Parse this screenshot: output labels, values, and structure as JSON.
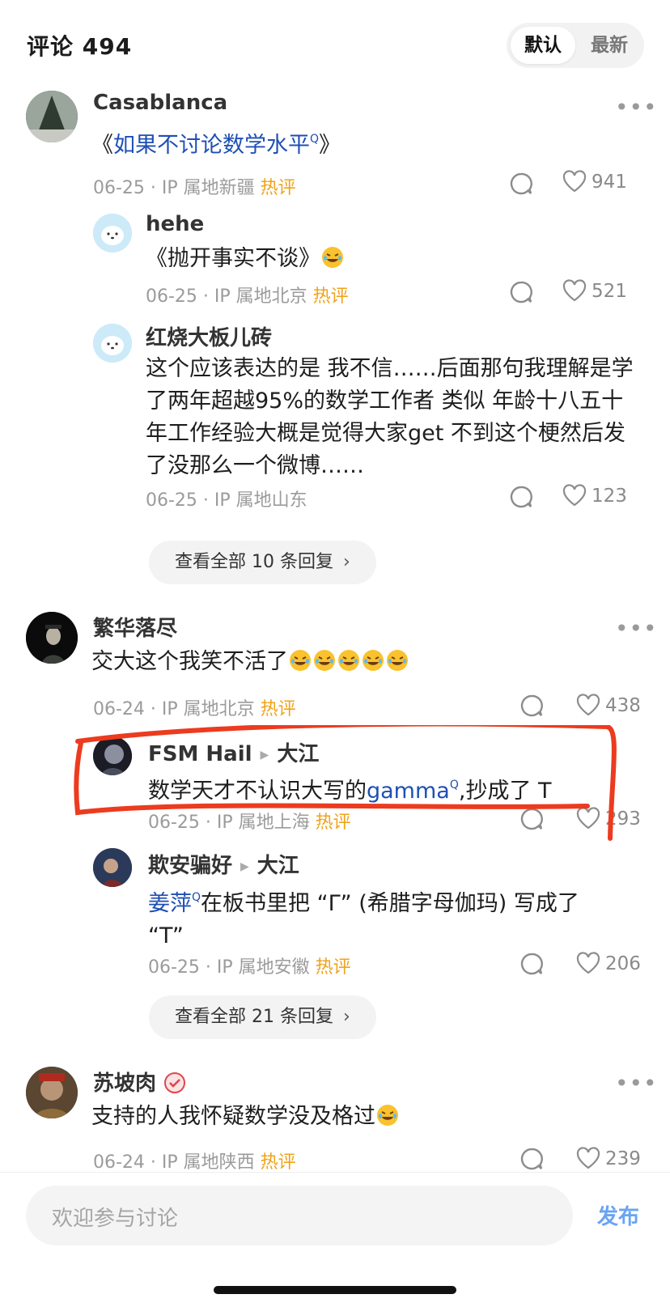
{
  "header": {
    "title": "评论 494",
    "sort_default": "默认",
    "sort_latest": "最新"
  },
  "comments": [
    {
      "user": "Casablanca",
      "text_prefix": "《",
      "text_link": "如果不讨论数学水平",
      "text_suffix": "》",
      "date": "06-25",
      "location": "IP 属地新疆",
      "tag": "热评",
      "likes": "941",
      "replies": [
        {
          "user": "hehe",
          "text": "《抛开事实不谈》",
          "date": "06-25",
          "location": "IP 属地北京",
          "tag": "热评",
          "likes": "521"
        },
        {
          "user": "红烧大板儿砖",
          "text": "这个应该表达的是 我不信……后面那句我理解是学了两年超越95%的数学工作者 类似 年龄十八五十年工作经验大概是觉得大家get 不到这个梗然后发了没那么一个微博……",
          "date": "06-25",
          "location": "IP 属地山东",
          "tag": "",
          "likes": "123"
        }
      ],
      "view_all": "查看全部 10 条回复"
    },
    {
      "user": "繁华落尽",
      "text": "交大这个我笑不活了",
      "date": "06-24",
      "location": "IP 属地北京",
      "tag": "热评",
      "likes": "438",
      "replies": [
        {
          "user": "FSM Hail",
          "reply_to": "大江",
          "text_prefix": "数学天才不认识大写的",
          "text_link": "gamma",
          "text_suffix": ",抄成了 T",
          "date": "06-25",
          "location": "IP 属地上海",
          "tag": "热评",
          "likes": "293"
        },
        {
          "user": "欺安骗好",
          "reply_to": "大江",
          "text_link": "姜萍",
          "text_suffix": "在板书里把 “Γ” (希腊字母伽玛) 写成了 “T”",
          "date": "06-25",
          "location": "IP 属地安徽",
          "tag": "热评",
          "likes": "206"
        }
      ],
      "view_all": "查看全部 21 条回复"
    },
    {
      "user": "苏坡肉",
      "text": "支持的人我怀疑数学没及格过",
      "date": "06-24",
      "location": "IP 属地陕西",
      "tag": "热评",
      "likes": "239"
    }
  ],
  "footer": {
    "placeholder": "欢迎参与讨论",
    "publish": "发布"
  },
  "colors": {
    "hot_tag": "#f0a21a",
    "link": "#1f4fb5",
    "publish": "#6aa4f2",
    "highlight_stroke": "#ec3b1f"
  },
  "icons": [
    "more-icon",
    "reply-icon",
    "heart-icon",
    "chevron-right-icon",
    "laugh-emoji-icon",
    "verified-badge-icon",
    "search-link-icon"
  ]
}
